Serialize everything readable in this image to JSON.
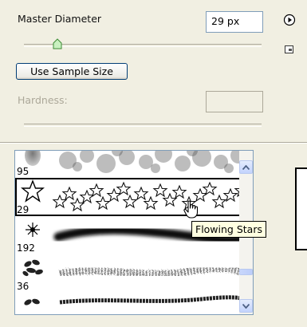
{
  "brush_options": {
    "master_diameter_label": "Master Diameter",
    "master_diameter_value": "29 px",
    "master_diameter_slider_fraction": 0.12,
    "use_sample_size_label": "Use Sample Size",
    "hardness_label": "Hardness:",
    "hardness_value": ""
  },
  "brush_list": {
    "items": [
      {
        "size": "95",
        "name": "",
        "thumb_icon": "soft-blob-icon"
      },
      {
        "size": "29",
        "name": "Flowing Stars",
        "thumb_icon": "star-outline-icon",
        "selected": true
      },
      {
        "size": "192",
        "name": "",
        "thumb_icon": "burst-icon"
      },
      {
        "size": "36",
        "name": "",
        "thumb_icon": "leaf-cluster-icon"
      },
      {
        "size": "",
        "name": "",
        "thumb_icon": "leaf-cluster-icon"
      }
    ]
  },
  "tooltip": {
    "text": "Flowing Stars"
  },
  "icons": {
    "panel_menu": "play-circle-icon",
    "new_preset": "new-preset-icon",
    "cursor": "hand-pointer-icon"
  },
  "colors": {
    "panel_bg": "#f1efe2",
    "scroll_accent": "#c3d3fd",
    "tooltip_bg": "#ffffe1"
  }
}
